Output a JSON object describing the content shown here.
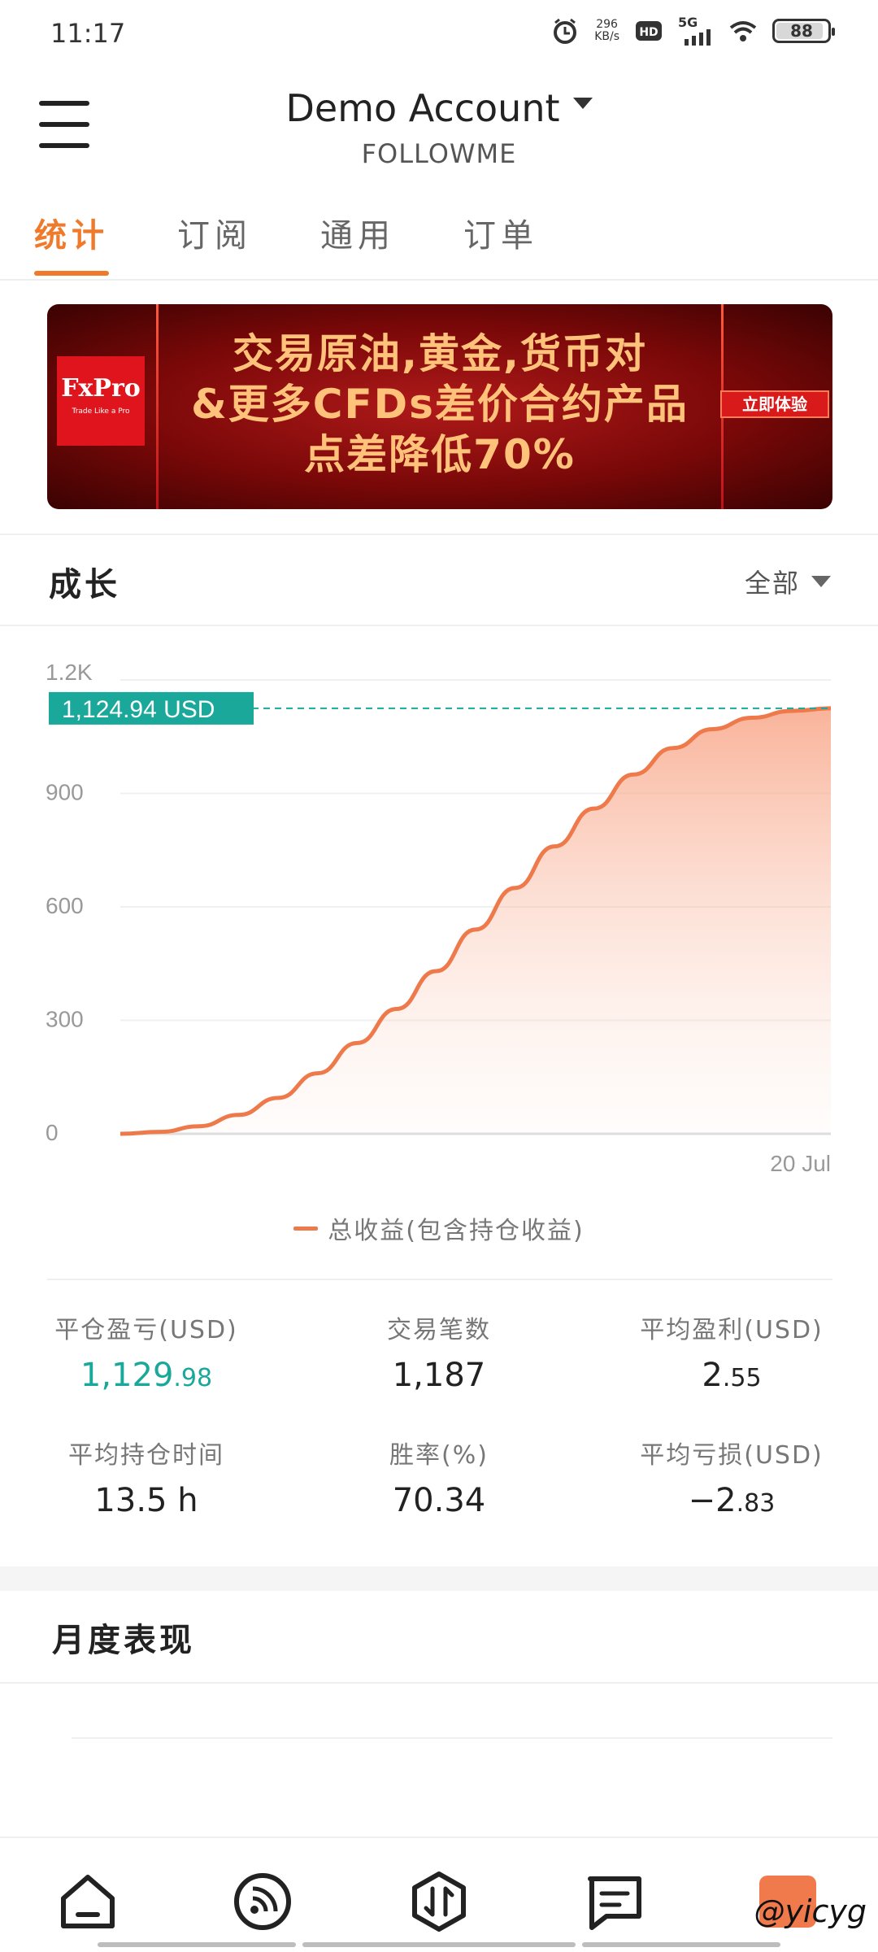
{
  "status_bar": {
    "time": "11:17",
    "speed_value": "296",
    "speed_unit": "KB/s",
    "network": "5G",
    "battery": "88"
  },
  "header": {
    "account_name": "Demo Account",
    "account_sub": "FOLLOWME"
  },
  "tabs": [
    {
      "label": "统计",
      "active": true
    },
    {
      "label": "订阅",
      "active": false
    },
    {
      "label": "通用",
      "active": false
    },
    {
      "label": "订单",
      "active": false
    }
  ],
  "banner": {
    "logo_main": "FxPro",
    "logo_sub": "Trade Like a Pro",
    "line1": "交易原油,黄金,货币对",
    "line2": "&更多CFDs差价合约产品",
    "line3": "点差降低70%",
    "cta": "立即体验"
  },
  "growth": {
    "title": "成长",
    "filter": "全部"
  },
  "chart_data": {
    "type": "area",
    "y_ticks": [
      "1.2K",
      "900",
      "600",
      "300",
      "0"
    ],
    "ylim": [
      0,
      1200
    ],
    "x_label_end": "20 Jul",
    "current_value_label": "1,124.94 USD",
    "current_value": 1124.94,
    "series": [
      {
        "name": "总收益(包含持仓收益)",
        "color": "#ee7a4c",
        "values": [
          0,
          5,
          20,
          50,
          95,
          160,
          240,
          330,
          430,
          540,
          650,
          760,
          860,
          950,
          1020,
          1070,
          1100,
          1118,
          1124.94
        ]
      }
    ],
    "grid": true,
    "legend": "bottom-center"
  },
  "legend_label": "总收益(包含持仓收益)",
  "stats": {
    "closed_pl_label": "平仓盈亏(USD)",
    "closed_pl_int": "1,129",
    "closed_pl_dec": ".98",
    "trades_label": "交易笔数",
    "trades_value": "1,187",
    "avg_profit_label": "平均盈利(USD)",
    "avg_profit_int": "2",
    "avg_profit_dec": ".55",
    "avg_hold_label": "平均持仓时间",
    "avg_hold_value": "13.5 h",
    "win_rate_label": "胜率(%)",
    "win_rate_value": "70.34",
    "avg_loss_label": "平均亏损(USD)",
    "avg_loss_int": "−2",
    "avg_loss_dec": ".83"
  },
  "monthly": {
    "title": "月度表现"
  },
  "watermark": "@yicyg",
  "colors": {
    "accent": "#f07a2c",
    "green": "#1aa89a",
    "line": "#ee7a4c"
  }
}
